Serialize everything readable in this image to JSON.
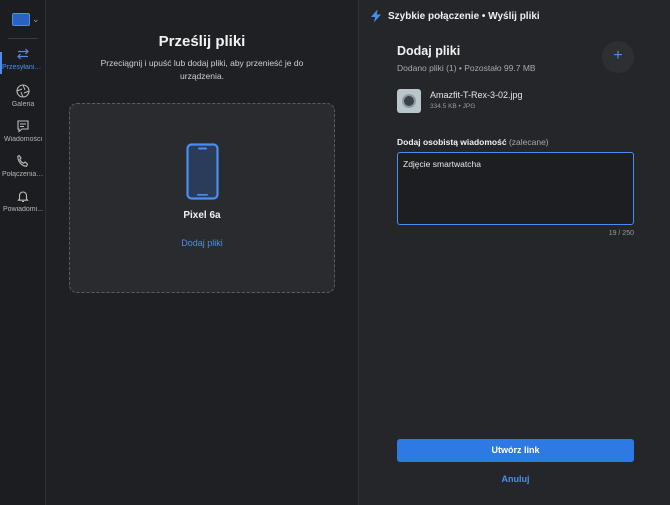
{
  "nav": {
    "items": [
      {
        "label": "Przesyłanie ...",
        "icon": "transfer-icon"
      },
      {
        "label": "Galeria",
        "icon": "camera-aperture-icon"
      },
      {
        "label": "Wiadomości",
        "icon": "message-icon"
      },
      {
        "label": "Połączenia t...",
        "icon": "phone-call-icon"
      },
      {
        "label": "Powiadomi...",
        "icon": "bell-icon"
      }
    ]
  },
  "left": {
    "title": "Prześlij pliki",
    "subtitle": "Przeciągnij i upuść lub dodaj pliki, aby przenieść je do urządzenia.",
    "device_name": "Pixel 6a",
    "add_files_link": "Dodaj pliki"
  },
  "right": {
    "header": "Szybkie połączenie • Wyślij pliki",
    "add_title": "Dodaj pliki",
    "add_subtitle": "Dodano pliki (1) • Pozostało 99.7 MB",
    "plus_label": "+",
    "file": {
      "name": "Amazfit-T-Rex-3-02.jpg",
      "meta": "334.5 KB • JPG"
    },
    "message_label": "Dodaj osobistą wiadomość",
    "message_label_optional": "(zalecane)",
    "message_value": "Zdjęcie smartwatcha",
    "counter": "19 / 250",
    "create_button": "Utwórz link",
    "cancel_button": "Anuluj"
  },
  "colors": {
    "accent": "#4a8ef0",
    "button": "#2d7ae5",
    "background": "#1f2023",
    "panel": "#25262a"
  }
}
